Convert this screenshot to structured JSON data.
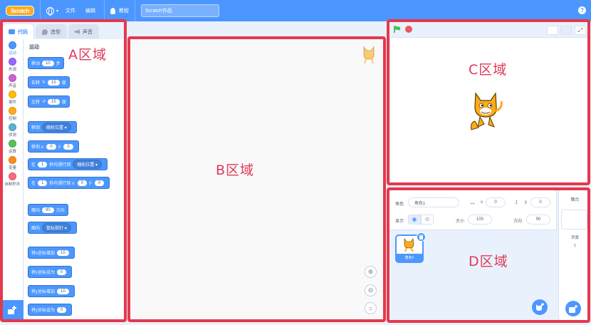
{
  "menubar": {
    "logo_text": "Scratch",
    "file": "文件",
    "edit": "编辑",
    "tutorials": "教程",
    "project_title": "Scratch作品",
    "help": "?"
  },
  "tabs": {
    "code": "代码",
    "costumes": "造型",
    "sounds": "声音"
  },
  "categories": [
    {
      "label": "运动",
      "color": "#4c97ff"
    },
    {
      "label": "外观",
      "color": "#9966ff"
    },
    {
      "label": "声音",
      "color": "#cf63cf"
    },
    {
      "label": "事件",
      "color": "#ffbf00"
    },
    {
      "label": "控制",
      "color": "#ffab19"
    },
    {
      "label": "侦测",
      "color": "#5cb1d6"
    },
    {
      "label": "运算",
      "color": "#59c059"
    },
    {
      "label": "变量",
      "color": "#ff8c1a"
    },
    {
      "label": "自制积木",
      "color": "#ff6680"
    }
  ],
  "blocks": {
    "heading": "运动",
    "move_a": "移动",
    "move_val": "10",
    "move_b": "步",
    "turn_right": "右转",
    "turn_right_val": "15",
    "turn_right_b": "度",
    "turn_left": "左转",
    "turn_left_val": "15",
    "turn_left_b": "度",
    "goto": "移到",
    "goto_dd": "随机位置",
    "gotoxy": "移到 x:",
    "gotoxy_x": "0",
    "gotoxy_y_label": "y:",
    "gotoxy_y": "0",
    "glide_a": "在",
    "glide_val": "1",
    "glide_b": "秒内滑行到",
    "glide_dd": "随机位置",
    "glidexy_a": "在",
    "glidexy_val": "1",
    "glidexy_b": "秒内滑行到 x:",
    "glidexy_x": "0",
    "glidexy_y_label": "y:",
    "glidexy_y": "0",
    "point": "面向",
    "point_val": "90",
    "point_b": "方向",
    "point_towards": "面向",
    "point_towards_dd": "鼠标指针",
    "change_x": "将x坐标增加",
    "change_x_val": "10",
    "set_x": "将x坐标设为",
    "set_x_val": "0",
    "change_y": "将y坐标增加",
    "change_y_val": "10",
    "set_y": "将y坐标设为",
    "set_y_val": "0"
  },
  "sprite_info": {
    "sprite_label": "角色",
    "sprite_name": "角色1",
    "x_label": "x",
    "x_val": "0",
    "y_label": "y",
    "y_val": "0",
    "show_label": "显示",
    "size_label": "大小",
    "size_val": "100",
    "direction_label": "方向",
    "direction_val": "90"
  },
  "sprites": [
    {
      "name": "角色1"
    }
  ],
  "stage_pane": {
    "title": "舞台",
    "backdrops_label": "背景",
    "backdrops_count": "1"
  },
  "regions": {
    "a": "A区域",
    "b": "B区域",
    "c": "C区域",
    "d": "D区域"
  },
  "colors": {
    "accent": "#4c97ff",
    "annotation": "#e4384d"
  }
}
